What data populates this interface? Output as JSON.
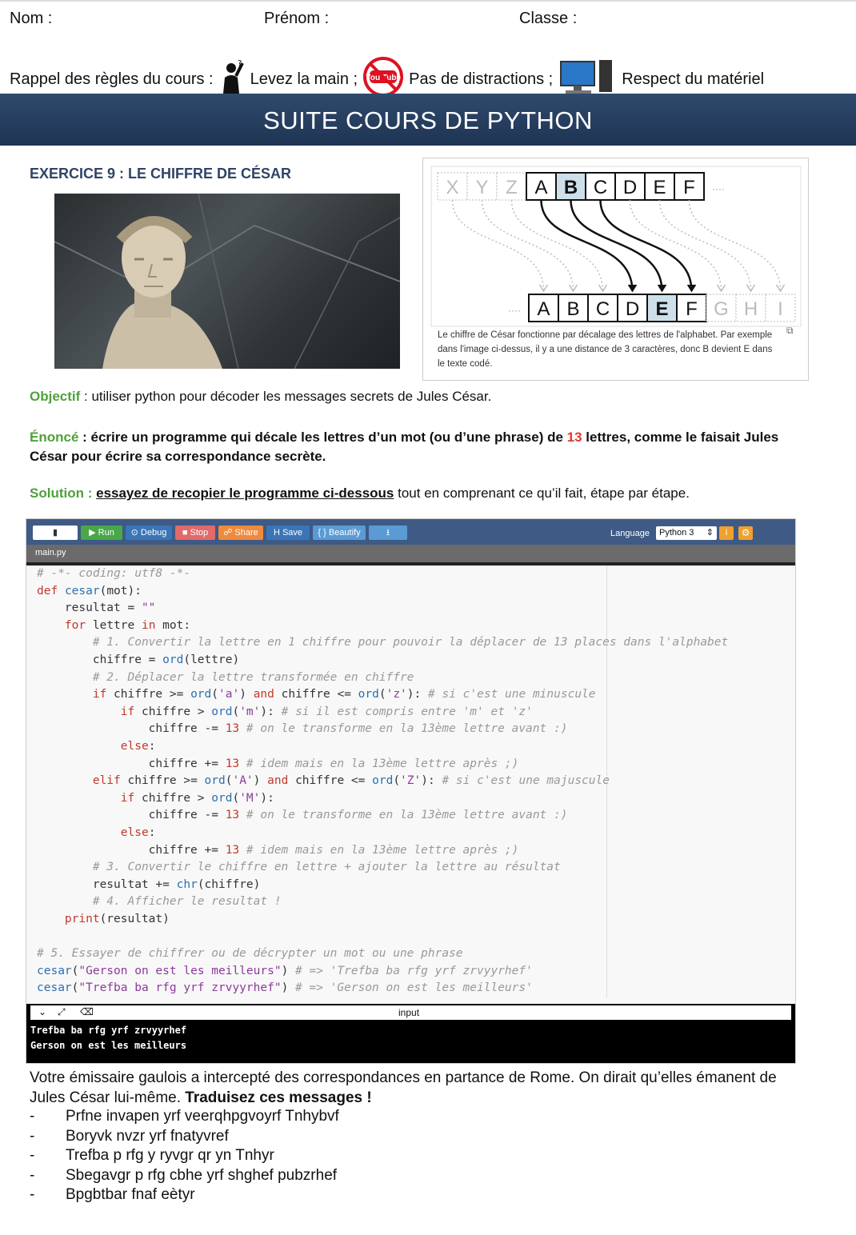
{
  "header": {
    "nom": "Nom :",
    "prenom": "Prénom :",
    "classe": "Classe :",
    "rules_intro": "Rappel des règles du cours :",
    "rule1": "Levez la main ;",
    "rule2": "Pas de distractions ;",
    "rule3": "Respect du matériel",
    "youtube_text": "You Tube"
  },
  "banner": {
    "title": "SUITE COURS DE PYTHON"
  },
  "exercise": {
    "title": "EXERCICE 9 : LE CHIFFRE DE CÉSAR"
  },
  "diagram": {
    "top_row": [
      "X",
      "Y",
      "Z",
      "A",
      "B",
      "C",
      "D",
      "E",
      "F"
    ],
    "bottom_row": [
      "A",
      "B",
      "C",
      "D",
      "E",
      "F",
      "G",
      "H",
      "I"
    ],
    "ellipsis": "····",
    "caption": "Le chiffre de César fonctionne par décalage des lettres de l'alphabet. Par exemple dans l'image ci-dessus, il y a une distance de 3 caractères, donc B devient E dans le texte codé."
  },
  "objectif": {
    "label": "Objectif",
    "text": " : utiliser python pour décoder les messages secrets de Jules César."
  },
  "enonce": {
    "label": "Énoncé",
    "text_a": " : écrire un programme qui décale les lettres d’un mot (ou d’une phrase) de ",
    "number": "13",
    "text_b": " lettres, comme le faisait Jules",
    "text_c": "César pour écrire sa correspondance secrète."
  },
  "solution": {
    "label": "Solution :",
    "link": "essayez de recopier le programme ci-dessous",
    "text": " tout en comprenant ce qu’il fait, étape par étape."
  },
  "ide": {
    "buttons": {
      "run": "▶ Run",
      "debug": "⊙ Debug",
      "stop": "■ Stop",
      "share": "☍ Share",
      "save": "H Save",
      "beautify": "{ } Beautify"
    },
    "language_label": "Language",
    "language_value": "Python 3",
    "tab": "main.py",
    "console_label": "input",
    "console_output": [
      "Trefba ba rfg yrf zrvyyrhef",
      "Gerson on est les meilleurs"
    ]
  },
  "exercise_text": {
    "p1a": "Votre émissaire gaulois a intercepté des correspondances en partance de Rome. On dirait qu’elles émanent de",
    "p1b": "Jules César lui-même. ",
    "p1c": "Traduisez ces messages !",
    "messages": [
      "Prfne invapen yrf veerqhpgvoyrf Tnhybvf",
      "Boryvk nvzr yrf fnatyvref",
      "Trefba p rfg y ryvgr qr yn Tnhyr",
      "Sbegavgr p rfg cbhe yrf shghef pubzrhef",
      "Bpgbtbar fnaf eètyr"
    ]
  }
}
